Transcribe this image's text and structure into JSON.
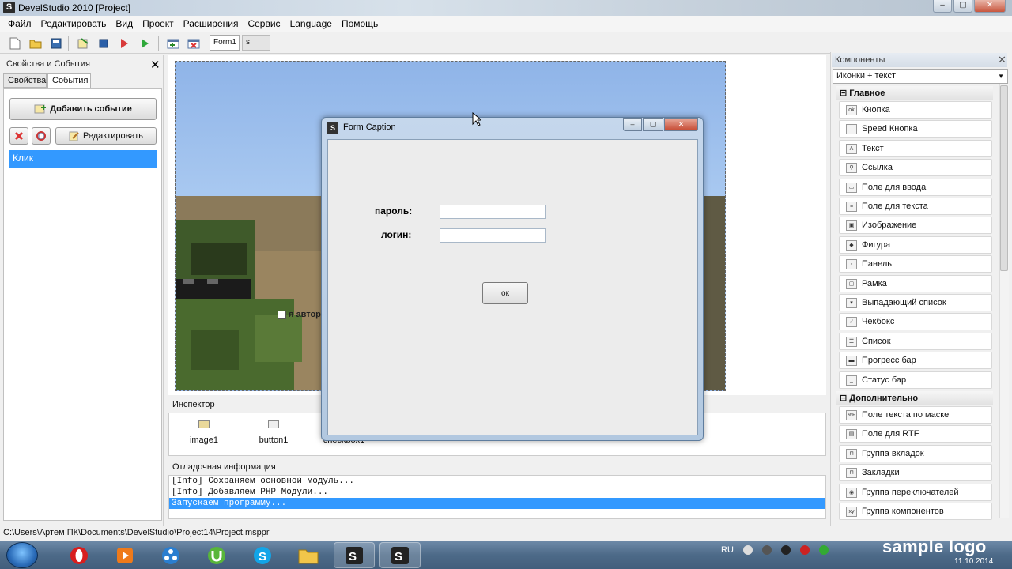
{
  "window": {
    "title": "DevelStudio 2010 [Project]",
    "buttons": [
      "–",
      "▢",
      "✕"
    ]
  },
  "menu": [
    "Файл",
    "Редактировать",
    "Вид",
    "Проект",
    "Расширения",
    "Сервис",
    "Language",
    "Помощь"
  ],
  "doc_tabs": {
    "form": "Form1",
    "second": "s"
  },
  "left_panel": {
    "title": "Свойства и События",
    "tabs": [
      "Свойства",
      "События"
    ],
    "active_tab": "События",
    "add_event": "Добавить событие",
    "edit": "Редактировать",
    "events": [
      "Клик"
    ]
  },
  "designer": {
    "checkbox_label": "я автор"
  },
  "dialog": {
    "title": "Form Caption",
    "label_password": "пароль:",
    "label_login": "логин:",
    "ok": "ок"
  },
  "inspector": {
    "title": "Инспектор",
    "components": [
      "image1",
      "button1",
      "checkbox1"
    ]
  },
  "debug": {
    "title": "Отладочная информация",
    "lines": [
      "[Info] Сохраняем основной модуль...",
      "[Info] Добавляем PHP Модули...",
      "Запускаем программу..."
    ],
    "selected_index": 2
  },
  "components_panel": {
    "title": "Компоненты",
    "view_mode": "Иконки + текст",
    "groups": [
      {
        "name": "Главное",
        "items": [
          {
            "label": "Кнопка",
            "icon": "ok"
          },
          {
            "label": "Speed Кнопка",
            "icon": ""
          },
          {
            "label": "Текст",
            "icon": "A"
          },
          {
            "label": "Ссылка",
            "icon": "⚲"
          },
          {
            "label": "Поле для ввода",
            "icon": "▭"
          },
          {
            "label": "Поле для текста",
            "icon": "≡"
          },
          {
            "label": "Изображение",
            "icon": "▣"
          },
          {
            "label": "Фигура",
            "icon": "◆"
          },
          {
            "label": "Панель",
            "icon": "▫"
          },
          {
            "label": "Рамка",
            "icon": "▢"
          },
          {
            "label": "Выпадающий список",
            "icon": "▾"
          },
          {
            "label": "Чекбокс",
            "icon": "✓"
          },
          {
            "label": "Список",
            "icon": "☰"
          },
          {
            "label": "Прогресс бар",
            "icon": "▬"
          },
          {
            "label": "Статус бар",
            "icon": "_"
          }
        ]
      },
      {
        "name": "Дополнительно",
        "items": [
          {
            "label": "Поле текста по маске",
            "icon": "%F"
          },
          {
            "label": "Поле для RTF",
            "icon": "▤"
          },
          {
            "label": "Группа вкладок",
            "icon": "⊓"
          },
          {
            "label": "Закладки",
            "icon": "⊓"
          },
          {
            "label": "Группа переключателей",
            "icon": "◉"
          },
          {
            "label": "Группа компонентов",
            "icon": "xy"
          }
        ]
      }
    ]
  },
  "status_path": "C:\\Users\\Артем ПК\\Documents\\DevelStudio\\Project14\\Project.msppr",
  "taskbar": {
    "lang": "RU",
    "logo": "sample logo",
    "date": "11.10.2014"
  }
}
